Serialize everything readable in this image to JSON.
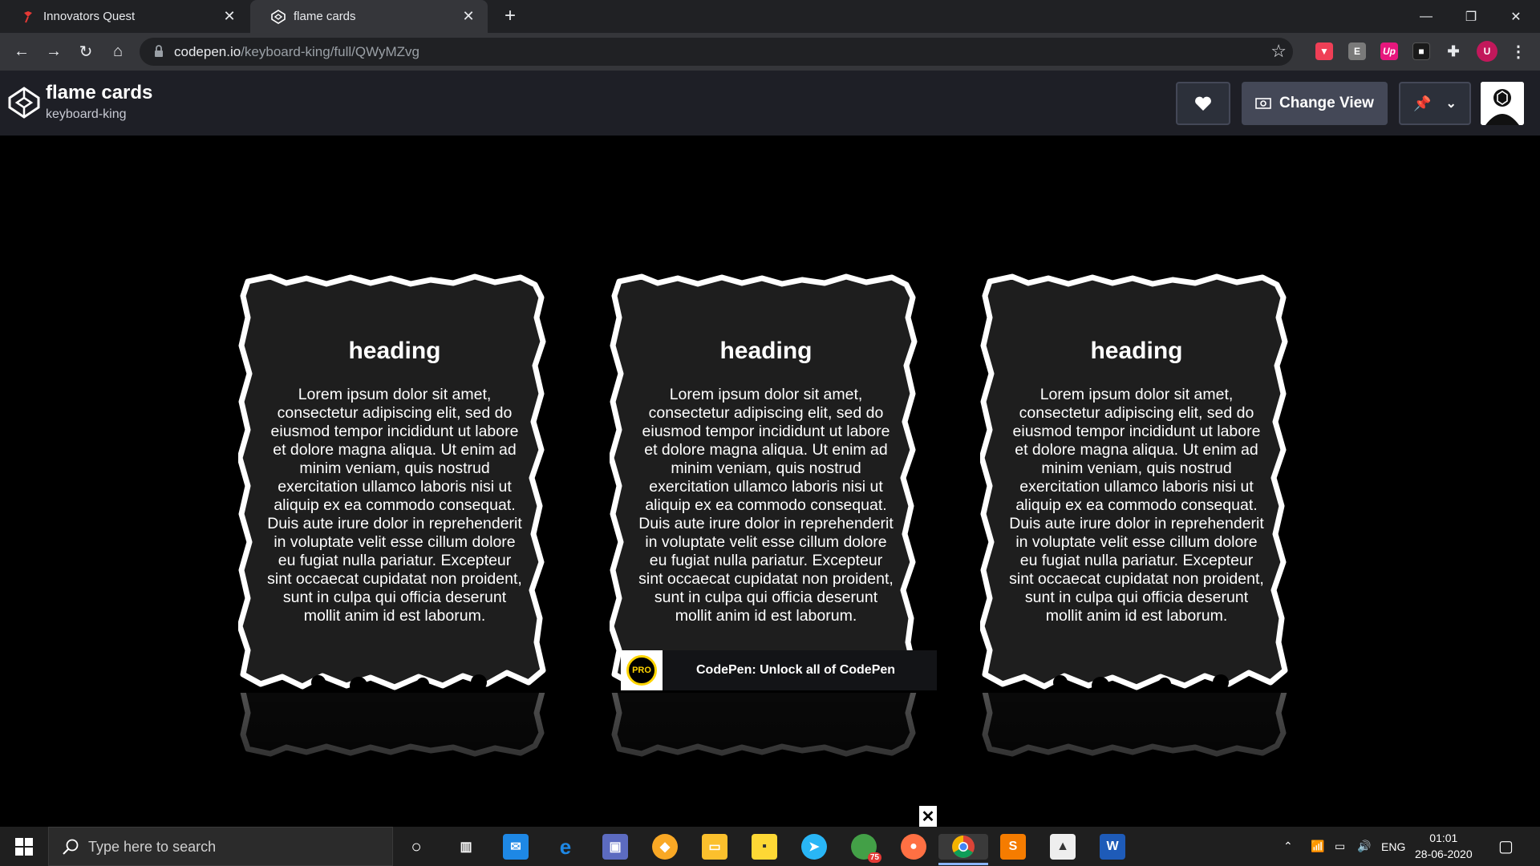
{
  "browser": {
    "tabs": [
      {
        "title": "Innovators Quest"
      },
      {
        "title": "flame cards"
      }
    ],
    "url_host": "codepen.io",
    "url_path": "/keyboard-king/full/QWyMZvg",
    "extensions": [
      "pocket",
      "E",
      "Up",
      "1"
    ],
    "profile_initial": "U"
  },
  "codepen": {
    "pen_title": "flame cards",
    "author": "keyboard-king",
    "change_view_label": "Change View"
  },
  "cards": [
    {
      "heading": "heading",
      "body": "Lorem ipsum dolor sit amet, consectetur adipiscing elit, sed do eiusmod tempor incididunt ut labore et dolore magna aliqua. Ut enim ad minim veniam, quis nostrud exercitation ullamco laboris nisi ut aliquip ex ea commodo consequat. Duis aute irure dolor in reprehenderit in voluptate velit esse cillum dolore eu fugiat nulla pariatur. Excepteur sint occaecat cupidatat non proident, sunt in culpa qui officia deserunt mollit anim id est laborum."
    },
    {
      "heading": "heading",
      "body": "Lorem ipsum dolor sit amet, consectetur adipiscing elit, sed do eiusmod tempor incididunt ut labore et dolore magna aliqua. Ut enim ad minim veniam, quis nostrud exercitation ullamco laboris nisi ut aliquip ex ea commodo consequat. Duis aute irure dolor in reprehenderit in voluptate velit esse cillum dolore eu fugiat nulla pariatur. Excepteur sint occaecat cupidatat non proident, sunt in culpa qui officia deserunt mollit anim id est laborum."
    },
    {
      "heading": "heading",
      "body": "Lorem ipsum dolor sit amet, consectetur adipiscing elit, sed do eiusmod tempor incididunt ut labore et dolore magna aliqua. Ut enim ad minim veniam, quis nostrud exercitation ullamco laboris nisi ut aliquip ex ea commodo consequat. Duis aute irure dolor in reprehenderit in voluptate velit esse cillum dolore eu fugiat nulla pariatur. Excepteur sint occaecat cupidatat non proident, sunt in culpa qui officia deserunt mollit anim id est laborum."
    }
  ],
  "pro_banner": {
    "badge": "PRO",
    "text": "CodePen: Unlock all of CodePen"
  },
  "taskbar": {
    "search_placeholder": "Type here to search",
    "whatsapp_badge": "75",
    "language": "ENG",
    "time": "01:01",
    "date": "28-06-2020"
  },
  "colors": {
    "card_fill": "#1e1e1e",
    "card_edge": "#ffffff",
    "page_bg": "#000000",
    "codepen_header": "#1e1f26",
    "chrome_dark": "#202124",
    "chrome_light": "#35363a"
  }
}
